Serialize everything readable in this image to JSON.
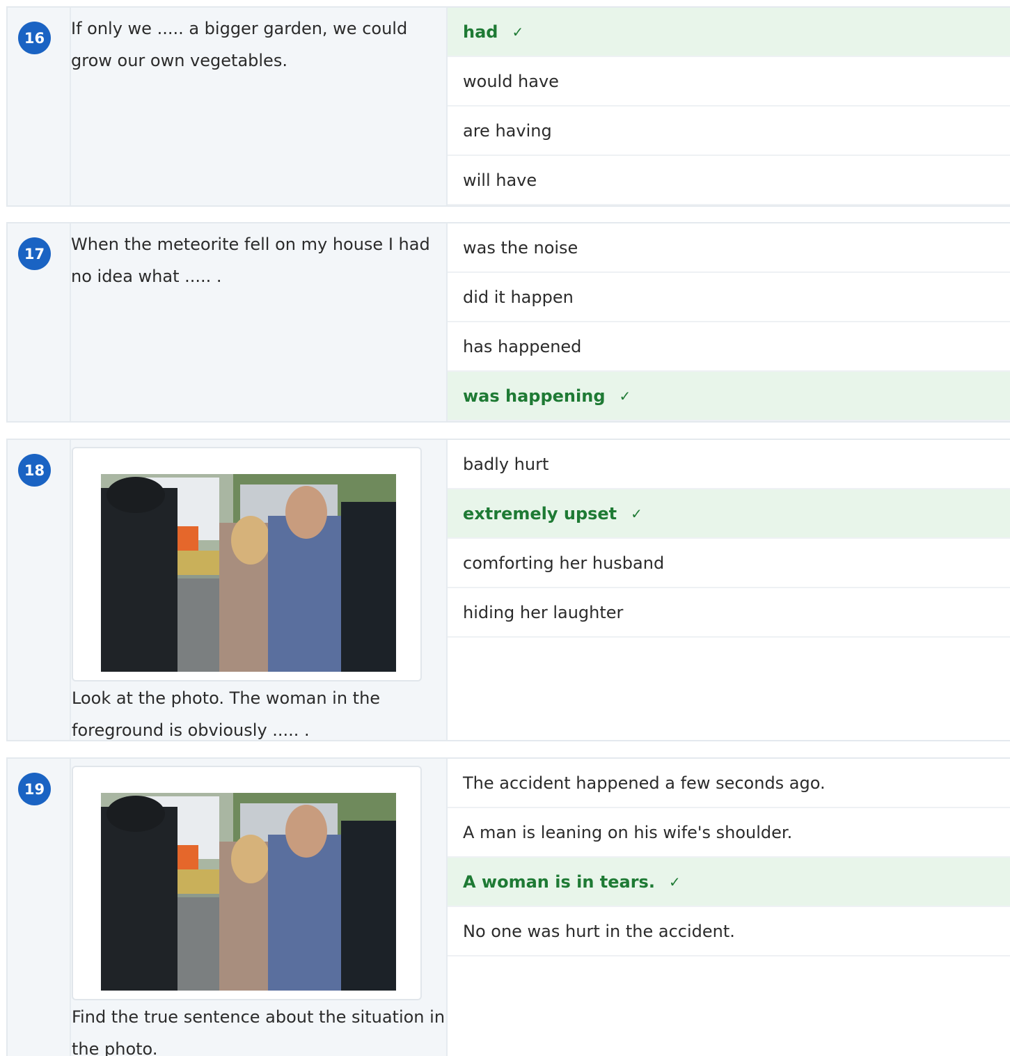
{
  "questions": [
    {
      "number": "16",
      "stem": "If only we ..... a bigger garden, we could grow our own vegetables.",
      "has_photo": false,
      "options": [
        {
          "text": "had",
          "correct": true
        },
        {
          "text": "would have",
          "correct": false
        },
        {
          "text": "are having",
          "correct": false
        },
        {
          "text": "will have",
          "correct": false
        }
      ]
    },
    {
      "number": "17",
      "stem": "When the meteorite fell on my house I had no idea what ..... .",
      "has_photo": false,
      "options": [
        {
          "text": "was the noise",
          "correct": false
        },
        {
          "text": "did it happen",
          "correct": false
        },
        {
          "text": "has happened",
          "correct": false
        },
        {
          "text": "was happening",
          "correct": true
        }
      ]
    },
    {
      "number": "18",
      "stem": "Look at the photo. The woman in the foreground is obviously ..... .",
      "has_photo": true,
      "options": [
        {
          "text": "badly hurt",
          "correct": false
        },
        {
          "text": "extremely upset",
          "correct": true
        },
        {
          "text": "comforting her husband",
          "correct": false
        },
        {
          "text": "hiding her laughter",
          "correct": false
        }
      ]
    },
    {
      "number": "19",
      "stem": "Find the true sentence about the situation in the photo.",
      "has_photo": true,
      "options": [
        {
          "text": "The accident happened a few seconds ago.",
          "correct": false
        },
        {
          "text": "A man is leaning on his wife's shoulder.",
          "correct": false
        },
        {
          "text": "A woman is in tears.",
          "correct": true
        },
        {
          "text": "No one was hurt in the accident.",
          "correct": false
        }
      ]
    }
  ],
  "check_mark": "✓",
  "colors": {
    "badge": "#1a63c3",
    "correct_bg": "#e8f5ea",
    "correct_text": "#1e7a34",
    "stem_bg": "#f3f6f9"
  }
}
